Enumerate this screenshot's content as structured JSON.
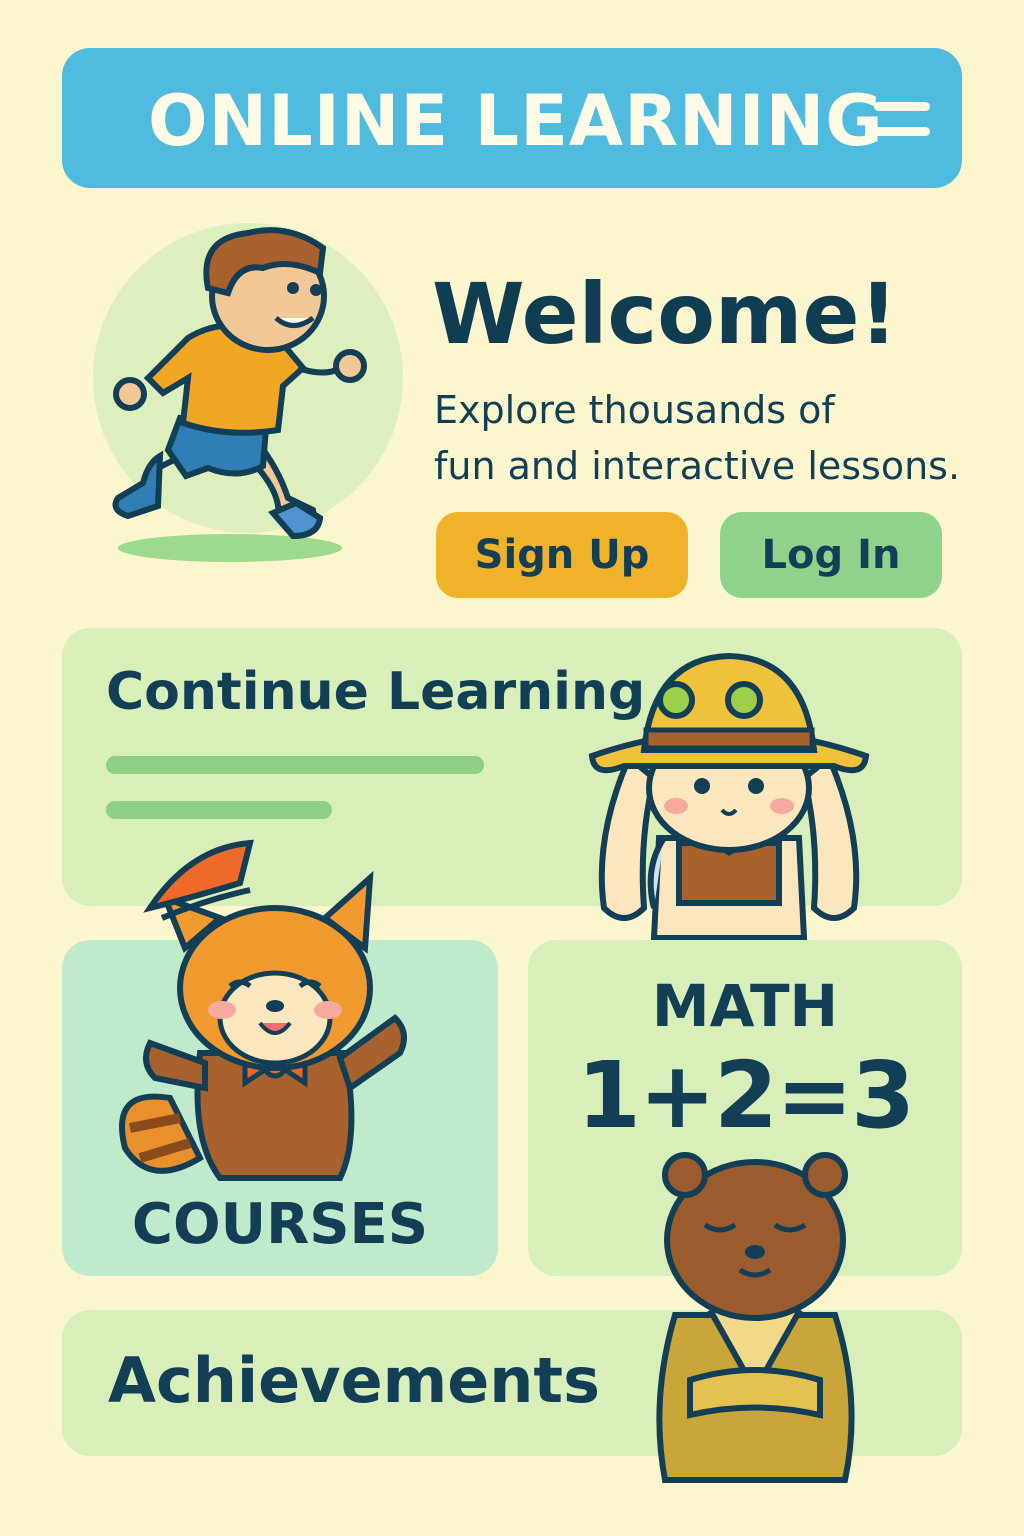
{
  "header": {
    "title": "ONLINE LEARNING",
    "menu_icon": "hamburger-menu-icon"
  },
  "hero": {
    "title": "Welcome!",
    "tagline_line1": "Explore thousands of",
    "tagline_line2": "fun and interactive lessons.",
    "signup_label": "Sign Up",
    "login_label": "Log In",
    "illustration": "running-boy-illustration"
  },
  "continue_learning": {
    "title": "Continue Learning",
    "illustration": "bunny-explorer-illustration"
  },
  "courses": {
    "label": "COURSES",
    "illustration": "red-panda-illustration"
  },
  "math": {
    "label": "MATH",
    "equation": "1+2=3"
  },
  "achievements": {
    "label": "Achievements",
    "illustration": "bear-monk-illustration"
  },
  "colors": {
    "background": "#fcf6cf",
    "header": "#4fbbdf",
    "signup": "#f0b229",
    "login": "#8fd28c",
    "card_green": "#d8efb9",
    "card_mint": "#bfebcc",
    "text_dark": "#123f55"
  }
}
